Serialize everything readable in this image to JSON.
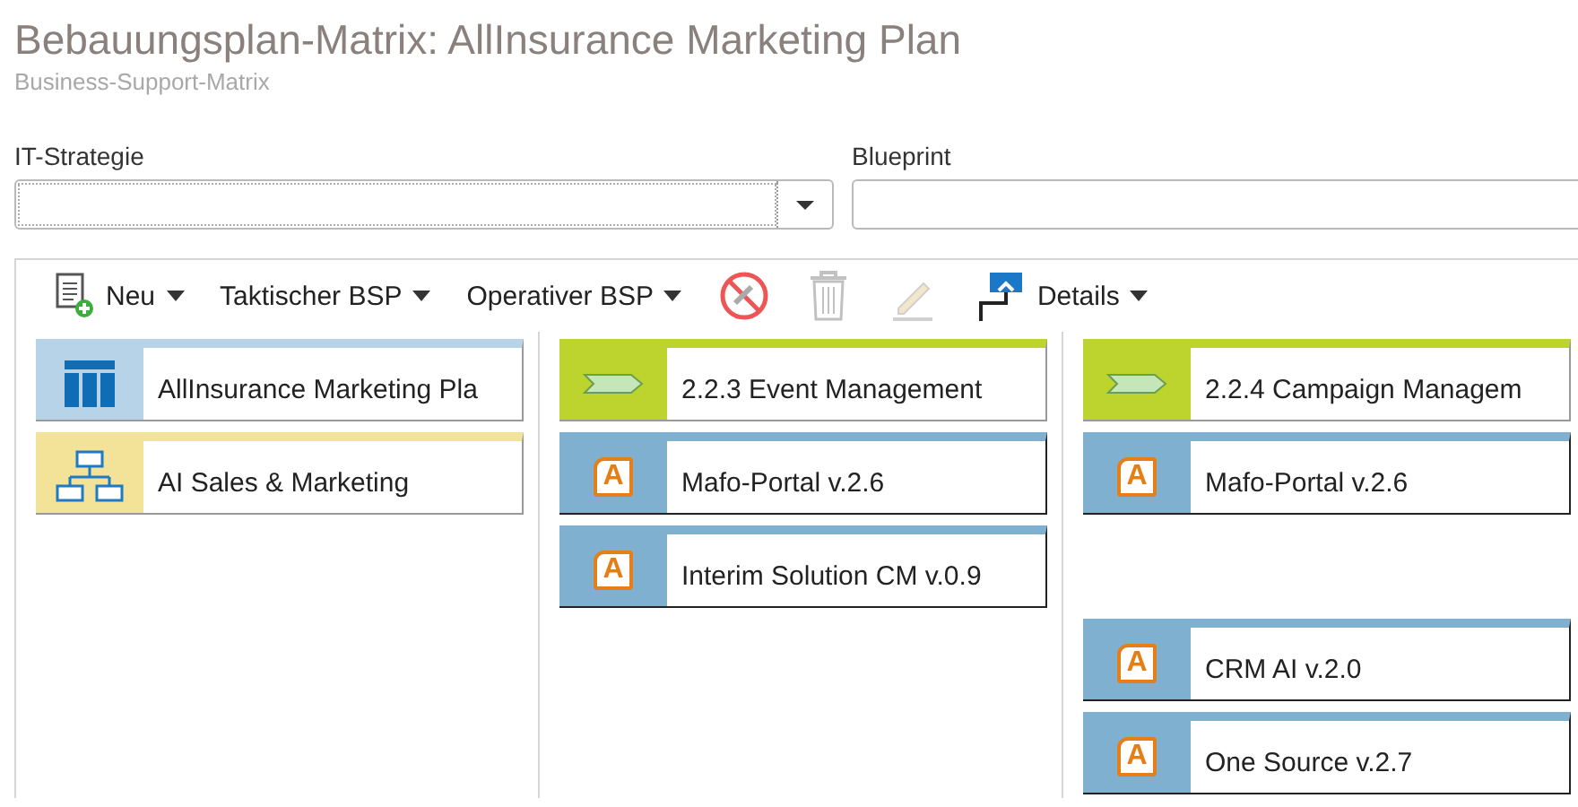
{
  "header": {
    "title": "Bebauungsplan-Matrix: AllInsurance Marketing Plan",
    "subtitle": "Business-Support-Matrix"
  },
  "filters": [
    {
      "label": "IT-Strategie",
      "kind": "select"
    },
    {
      "label": "Blueprint",
      "kind": "text"
    }
  ],
  "toolbar": [
    {
      "kind": "new",
      "label": "Neu",
      "disabled": false
    },
    {
      "kind": "menu",
      "label": "Taktischer BSP",
      "disabled": false
    },
    {
      "kind": "menu",
      "label": "Operativer BSP",
      "disabled": false
    },
    {
      "kind": "unlink",
      "disabled": false
    },
    {
      "kind": "delete",
      "disabled": true
    },
    {
      "kind": "edit",
      "disabled": true
    },
    {
      "kind": "details",
      "label": "Details",
      "disabled": false
    }
  ],
  "columns": [
    {
      "cards": [
        {
          "kind": "plan",
          "label": "AllInsurance Marketing Pla"
        },
        {
          "kind": "org",
          "label": "AI Sales & Marketing"
        }
      ]
    },
    {
      "cards": [
        {
          "kind": "process",
          "label": "2.2.3 Event Management"
        },
        {
          "kind": "application",
          "badge": "A",
          "label": "Mafo-Portal v.2.6"
        },
        {
          "kind": "application",
          "badge": "A",
          "label": "Interim Solution CM v.0.9"
        }
      ]
    },
    {
      "cards": [
        {
          "kind": "process",
          "label": "2.2.4 Campaign Managem"
        },
        {
          "kind": "application",
          "badge": "A",
          "label": "Mafo-Portal v.2.6"
        },
        {
          "kind": "spacer"
        },
        {
          "kind": "application",
          "badge": "A",
          "label": "CRM AI v.2.0"
        },
        {
          "kind": "application",
          "badge": "A",
          "label": "One Source v.2.7"
        }
      ]
    }
  ]
}
